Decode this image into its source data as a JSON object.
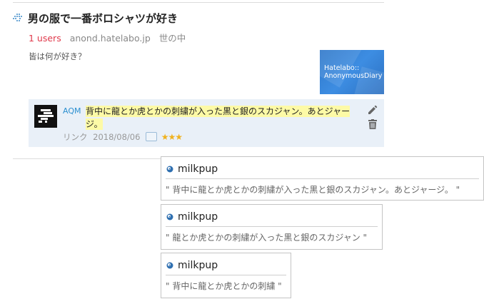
{
  "entry": {
    "title": "男の服で一番ボロシャツが好き",
    "users": "1 users",
    "domain": "anond.hatelabo.jp",
    "category": "世の中",
    "summary": "皆は何が好き？",
    "thumbnail_caption_line1": "Hatelabo::",
    "thumbnail_caption_line2": "AnonymousDiary"
  },
  "comment": {
    "user": "AQM",
    "text": "背中に龍とか虎とかの刺繍が入った黒と銀のスカジャン。あとジャージ。",
    "link_label": "リンク",
    "date": "2018/08/06",
    "stars": "★★★",
    "colors": {
      "highlight": "#fdfaa6",
      "star": "#f0b21f",
      "user": "#2b8fd0"
    }
  },
  "quotes": [
    {
      "user": "milkpup",
      "text": "\" 背中に龍とか虎とかの刺繍が入った黒と銀のスカジャン。あとジャージ。 \""
    },
    {
      "user": "milkpup",
      "text": "\" 龍とか虎とかの刺繍が入った黒と銀のスカジャン \""
    },
    {
      "user": "milkpup",
      "text": "\" 背中に龍とか虎とかの刺繍 \""
    }
  ],
  "icons": {
    "entry_favicon": "hatena-favicon-icon",
    "edit": "pencil-icon",
    "delete": "trash-icon",
    "quote_user": "eye-icon"
  }
}
